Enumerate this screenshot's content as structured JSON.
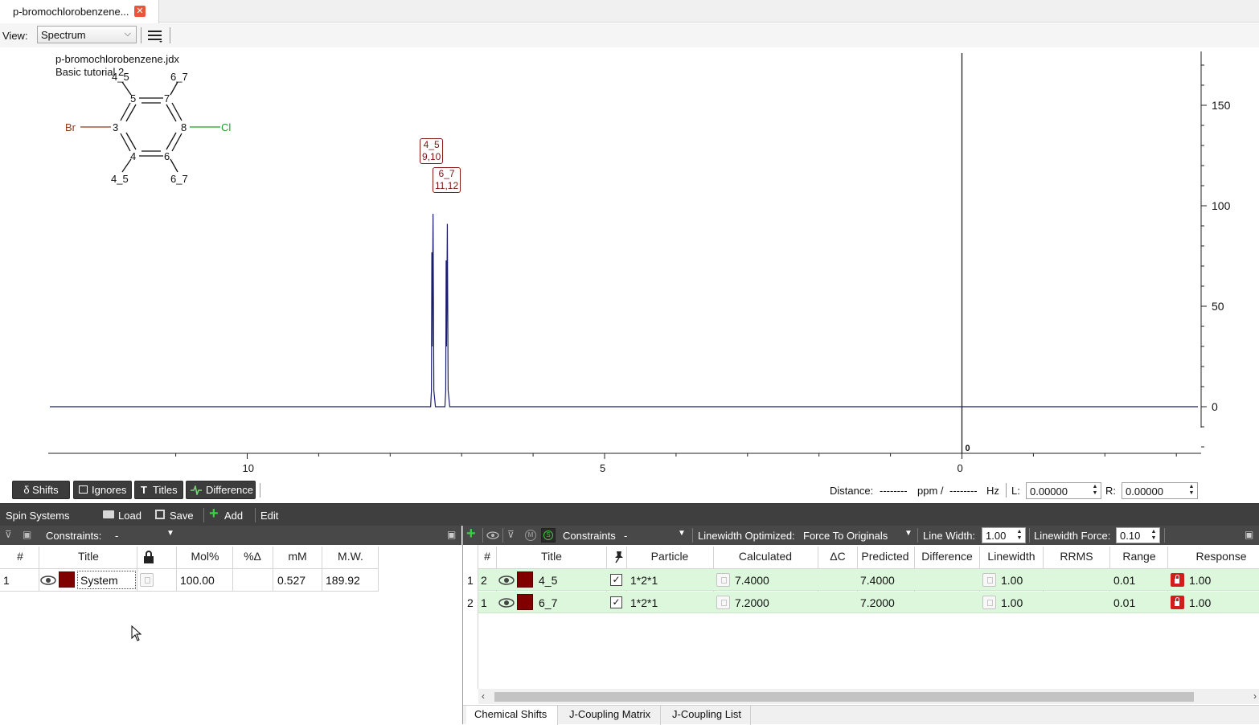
{
  "tab": {
    "title": "p-bromochlorobenzene...",
    "close_icon": "close-icon"
  },
  "viewbar": {
    "label": "View:",
    "selected": "Spectrum"
  },
  "molecule": {
    "file": "p-bromochlorobenzene.jdx",
    "subtitle": "Basic tutorial 2",
    "atom_labels": {
      "top_left": "4_5",
      "top_right": "6_7",
      "bottom_left": "4_5",
      "bottom_right": "6_7",
      "c5": "5",
      "c7": "7",
      "c3": "3",
      "c8": "8",
      "c4": "4",
      "c6": "6",
      "br": "Br",
      "cl": "Cl"
    }
  },
  "chart_data": {
    "type": "line",
    "x_axis": {
      "ticks": [
        "10",
        "5",
        "0"
      ],
      "range": [
        11.4,
        -3.0
      ],
      "reversed": true,
      "marker_label": "0"
    },
    "y_axis": {
      "ticks": [
        "150",
        "100",
        "50",
        "0"
      ],
      "range": [
        -25,
        175
      ]
    },
    "peaks": [
      {
        "label": "4_5",
        "sub": "9,10",
        "x": 7.4,
        "y": 96
      },
      {
        "label": "6_7",
        "sub": "11,12",
        "x": 7.2,
        "y": 91
      }
    ]
  },
  "spec_toolbar": {
    "shifts": "δ Shifts",
    "ignores": "Ignores",
    "titles": "Titles",
    "difference": "Difference",
    "distance_label": "Distance:",
    "distance_ppm": "--------",
    "ppm_unit": "ppm /",
    "distance_hz": "--------",
    "hz_unit": "Hz",
    "l_label": "L:",
    "l_value": "0.00000",
    "r_label": "R:",
    "r_value": "0.00000"
  },
  "spin_systems": {
    "title": "Spin Systems",
    "load": "Load",
    "save": "Save",
    "add": "Add",
    "edit": "Edit"
  },
  "left": {
    "constraints_label": "Constraints:",
    "constraints_value": "-",
    "headers": {
      "num": "#",
      "title": "Title",
      "mol": "Mol%",
      "pct": "%Δ",
      "mm": "mM",
      "mw": "M.W."
    },
    "row": {
      "num": "1",
      "title": "System",
      "mol": "100.00",
      "pct": "",
      "mm": "0.527",
      "mw": "189.92"
    }
  },
  "right": {
    "constraints_label": "Constraints",
    "constraints_value": "-",
    "linewidth_opt_label": "Linewidth Optimized:",
    "linewidth_opt_value": "Force To Originals",
    "line_width_label": "Line Width:",
    "line_width_value": "1.00",
    "linewidth_force_label": "Linewidth Force:",
    "linewidth_force_value": "0.10",
    "headers": {
      "num": "#",
      "title": "Title",
      "particle": "Particle",
      "calculated": "Calculated",
      "dc": "ΔC",
      "predicted": "Predicted",
      "difference": "Difference",
      "linewidth": "Linewidth",
      "rrms": "RRMS",
      "range": "Range",
      "response": "Response"
    },
    "rows": [
      {
        "row": "1",
        "num": "2",
        "title": "4_5",
        "particle": "1*2*1",
        "calculated": "7.4000",
        "predicted": "7.4000",
        "linewidth": "1.00",
        "range": "0.01",
        "response": "1.00"
      },
      {
        "row": "2",
        "num": "1",
        "title": "6_7",
        "particle": "1*2*1",
        "calculated": "7.2000",
        "predicted": "7.2000",
        "linewidth": "1.00",
        "range": "0.01",
        "response": "1.00"
      }
    ],
    "tabs": [
      "Chemical Shifts",
      "J-Coupling Matrix",
      "J-Coupling List"
    ]
  },
  "colors": {
    "system": "#800000",
    "row_bg": "#ddf7dd",
    "spectrum": "#1b1f6b",
    "dark_bar": "#3f3f3f"
  }
}
